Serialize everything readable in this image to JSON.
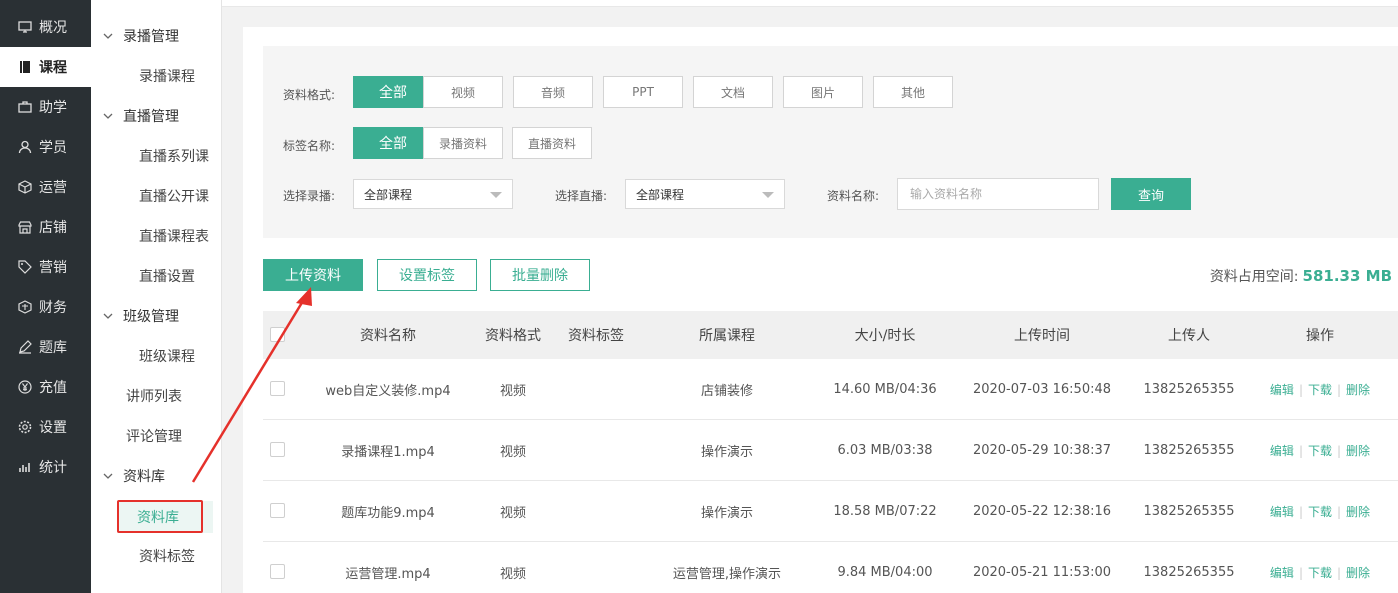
{
  "rail": [
    {
      "label": "概况",
      "icon": "monitor-icon"
    },
    {
      "label": "课程",
      "icon": "book-icon",
      "active": true
    },
    {
      "label": "助学",
      "icon": "briefcase-icon"
    },
    {
      "label": "学员",
      "icon": "user-icon"
    },
    {
      "label": "运营",
      "icon": "cube-icon"
    },
    {
      "label": "店铺",
      "icon": "store-icon"
    },
    {
      "label": "营销",
      "icon": "tag-icon"
    },
    {
      "label": "财务",
      "icon": "wallet-icon"
    },
    {
      "label": "题库",
      "icon": "pencil-icon"
    },
    {
      "label": "充值",
      "icon": "yen-icon"
    },
    {
      "label": "设置",
      "icon": "gear-icon"
    },
    {
      "label": "统计",
      "icon": "chart-icon"
    }
  ],
  "submenu": {
    "g1": "录播管理",
    "g1_items": [
      "录播课程"
    ],
    "g2": "直播管理",
    "g2_items": [
      "直播系列课",
      "直播公开课",
      "直播课程表",
      "直播设置"
    ],
    "g3": "班级管理",
    "g3_items": [
      "班级课程"
    ],
    "plain1": "讲师列表",
    "plain2": "评论管理",
    "g4": "资料库",
    "g4_active": "资料库",
    "g4_items": [
      "资料标签"
    ]
  },
  "filters": {
    "format_label": "资料格式:",
    "formats": [
      "全部",
      "视频",
      "音频",
      "PPT",
      "文档",
      "图片",
      "其他"
    ],
    "tag_label": "标签名称:",
    "tags": [
      "全部",
      "录播资料",
      "直播资料"
    ],
    "recorded_label": "选择录播:",
    "recorded_value": "全部课程",
    "live_label": "选择直播:",
    "live_value": "全部课程",
    "name_label": "资料名称:",
    "name_placeholder": "输入资料名称",
    "query": "查询"
  },
  "actions": {
    "upload": "上传资料",
    "set_tag": "设置标签",
    "batch_delete": "批量删除",
    "storage_label": "资料占用空间:",
    "storage_value": "581.33 MB"
  },
  "table": {
    "headers": [
      "资料名称",
      "资料格式",
      "资料标签",
      "所属课程",
      "大小/时长",
      "上传时间",
      "上传人",
      "操作"
    ],
    "rows": [
      {
        "name": "web自定义装修.mp4",
        "format": "视频",
        "tag": "",
        "course": "店铺装修",
        "size": "14.60 MB/04:36",
        "time": "2020-07-03 16:50:48",
        "uploader": "13825265355"
      },
      {
        "name": "录播课程1.mp4",
        "format": "视频",
        "tag": "",
        "course": "操作演示",
        "size": "6.03 MB/03:38",
        "time": "2020-05-29 10:38:37",
        "uploader": "13825265355"
      },
      {
        "name": "题库功能9.mp4",
        "format": "视频",
        "tag": "",
        "course": "操作演示",
        "size": "18.58 MB/07:22",
        "time": "2020-05-22 12:38:16",
        "uploader": "13825265355"
      },
      {
        "name": "运营管理.mp4",
        "format": "视频",
        "tag": "",
        "course": "运营管理,操作演示",
        "size": "9.84 MB/04:00",
        "time": "2020-05-21 11:53:00",
        "uploader": "13825265355"
      }
    ],
    "ops": {
      "edit": "编辑",
      "download": "下载",
      "delete": "删除",
      "sep": "|"
    }
  },
  "colors": {
    "accent": "#3aae92",
    "rail_bg": "#2a3034",
    "highlight": "#e5312b"
  }
}
